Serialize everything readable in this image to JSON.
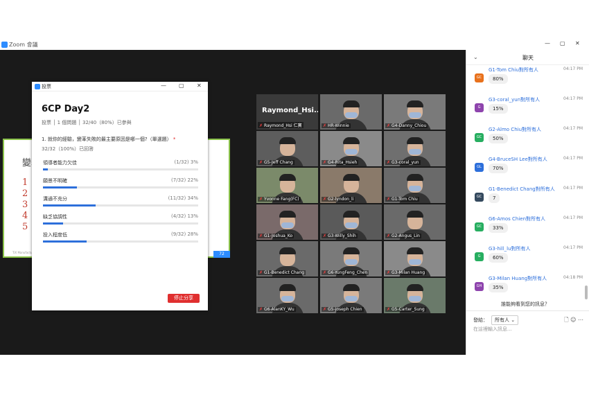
{
  "window": {
    "app_title": "Zoom 會議",
    "minimize": "—",
    "maximize": "▢",
    "close": "✕"
  },
  "slide": {
    "title": "變革",
    "numbers": [
      "1",
      "2",
      "3",
      "4",
      "5"
    ],
    "footer": "TiX Manufacturing Taiwan",
    "page": "72"
  },
  "poll": {
    "window_title": "投票",
    "title": "6CP Day2",
    "meta": "投票 │ 1 個問題 │ 32/40（80%）已參與",
    "question": "1. 就你的經驗，變革失敗的最主要原因是哪一個?（單選題）",
    "required_mark": "*",
    "answered": "32/32（100%）已回答",
    "options": [
      {
        "label": "領導者能力欠佳",
        "value": "(1/32) 3%",
        "fraction": 0.03
      },
      {
        "label": "願景不明確",
        "value": "(7/32) 22%",
        "fraction": 0.22
      },
      {
        "label": "溝通不充分",
        "value": "(11/32) 34%",
        "fraction": 0.34
      },
      {
        "label": "缺乏協調性",
        "value": "(4/32) 13%",
        "fraction": 0.13
      },
      {
        "label": "投入程度低",
        "value": "(9/32) 28%",
        "fraction": 0.28
      }
    ],
    "stop_share": "停止分享",
    "win_min": "—",
    "win_max": "▢",
    "win_close": "✕"
  },
  "gallery": [
    {
      "name": "Raymond_Hsi 仁寶",
      "big": "Raymond_Hsi...",
      "mask": false
    },
    {
      "name": "HR-Winnie",
      "mask": true
    },
    {
      "name": "G4-Danny_Chiou",
      "mask": true
    },
    {
      "name": "G5-Jeff Chang",
      "mask": false
    },
    {
      "name": "G4-Rita_Hsieh",
      "mask": true
    },
    {
      "name": "G3-coral_yun",
      "mask": true
    },
    {
      "name": "Yvonne Fang(FC)",
      "mask": false,
      "active": true
    },
    {
      "name": "G2-lyndon_li",
      "mask": false
    },
    {
      "name": "G1-Tom Chiu",
      "mask": true
    },
    {
      "name": "G1-Joshua_Ko",
      "mask": true
    },
    {
      "name": "G3-Willy_Shih",
      "mask": true
    },
    {
      "name": "G2-Angus_Lin",
      "mask": false
    },
    {
      "name": "G1-Benedict Chang",
      "mask": false
    },
    {
      "name": "G6-YungFeng_Chen",
      "mask": true
    },
    {
      "name": "G3-Milan Huang",
      "mask": true
    },
    {
      "name": "G6-AlanKY_Wu",
      "mask": true
    },
    {
      "name": "G5-joseph Chien",
      "mask": true
    },
    {
      "name": "G5-Carter_Sung",
      "mask": true
    }
  ],
  "chat": {
    "title": "聊天",
    "collapse": "⌄",
    "messages": [
      {
        "avatar": "GC",
        "color": "#e8711c",
        "sender": "G1-Tom Chiu對所有人",
        "time": "04:17 PM",
        "text": "80%"
      },
      {
        "avatar": "G",
        "color": "#8e44ad",
        "sender": "G3-coral_yun對所有人",
        "time": "04:17 PM",
        "text": "15%"
      },
      {
        "avatar": "GC",
        "color": "#27ae60",
        "sender": "G2-Almo Chiu對所有人",
        "time": "04:17 PM",
        "text": "50%"
      },
      {
        "avatar": "GL",
        "color": "#2d6fdb",
        "sender": "G4-BruceSH Lee對所有人",
        "time": "04:17 PM",
        "text": "70%"
      },
      {
        "avatar": "GC",
        "color": "#34495e",
        "sender": "G1-Benedict Chang對所有人",
        "time": "04:17 PM",
        "text": "7"
      },
      {
        "avatar": "GC",
        "color": "#27ae60",
        "sender": "G6-Amos Chien對所有人",
        "time": "04:17 PM",
        "text": "33%"
      },
      {
        "avatar": "G",
        "color": "#27ae60",
        "sender": "G3-hill_lu對所有人",
        "time": "04:17 PM",
        "text": "60%"
      },
      {
        "avatar": "GH",
        "color": "#8e44ad",
        "sender": "G3-Milan Huang對所有人",
        "time": "04:18 PM",
        "text": "35%"
      }
    ],
    "who_can_see": "誰能夠看到您的訊息？",
    "send_to_label": "發給：",
    "recipient": "所有人 ⌄",
    "placeholder": "在這裡輸入訊息...",
    "tools": "🗋 ☺ ⋯"
  }
}
